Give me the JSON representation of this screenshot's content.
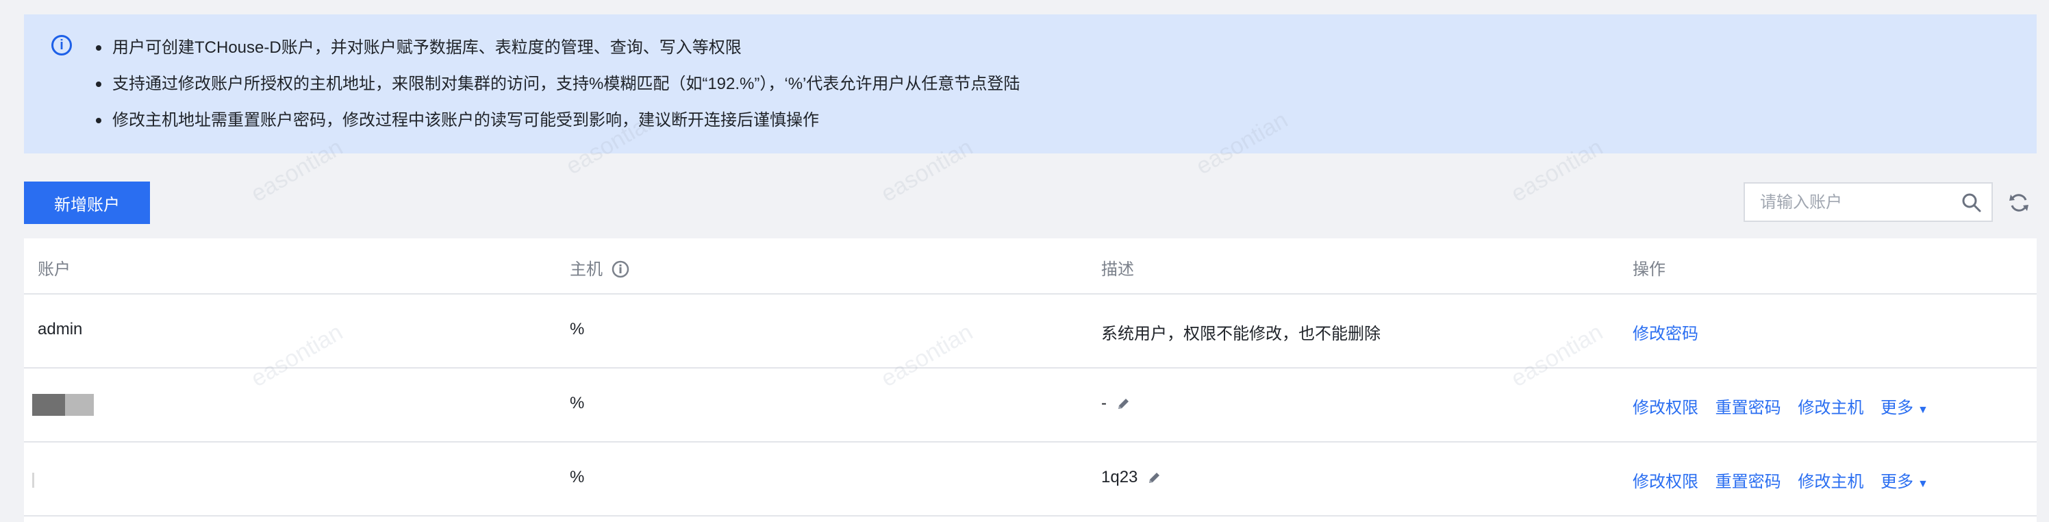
{
  "notice": {
    "items": [
      "用户可创建TCHouse-D账户，并对账户赋予数据库、表粒度的管理、查询、写入等权限",
      "支持通过修改账户所授权的主机地址，来限制对集群的访问，支持%模糊匹配（如“192.%”），‘%’代表允许用户从任意节点登陆",
      "修改主机地址需重置账户密码，修改过程中该账户的读写可能受到影响，建议断开连接后谨慎操作"
    ]
  },
  "toolbar": {
    "add_button": "新增账户",
    "search_placeholder": "请输入账户",
    "search_icon": "search-icon",
    "refresh_icon": "refresh-icon"
  },
  "table": {
    "headers": {
      "account": "账户",
      "host": "主机",
      "desc": "描述",
      "actions": "操作"
    },
    "rows": [
      {
        "account": "admin",
        "host": "%",
        "desc": "系统用户，权限不能修改，也不能删除",
        "actions": [
          "修改密码"
        ]
      },
      {
        "account": "",
        "host": "%",
        "desc": "-",
        "actions": [
          "修改权限",
          "重置密码",
          "修改主机",
          "更多"
        ]
      },
      {
        "account": "",
        "host": "%",
        "desc": "1q23",
        "actions": [
          "修改权限",
          "重置密码",
          "修改主机",
          "更多"
        ]
      }
    ]
  },
  "watermark_text": "easontian"
}
